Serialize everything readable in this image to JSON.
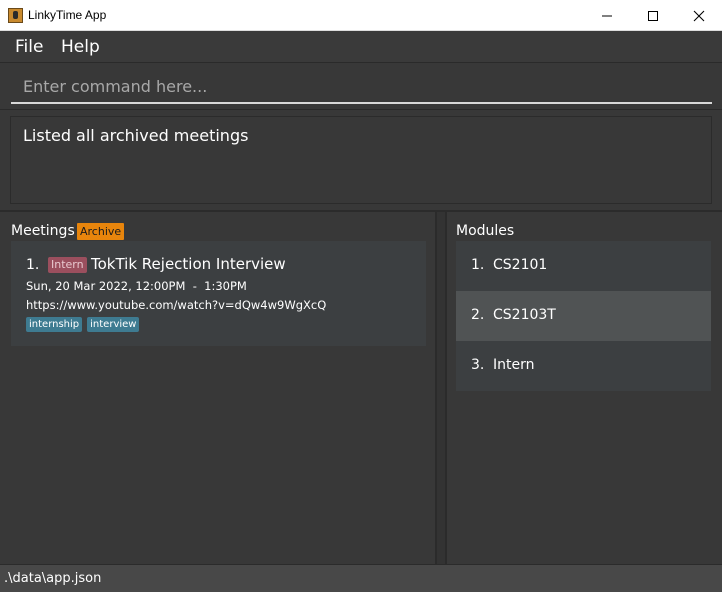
{
  "window": {
    "title": "LinkyTime App",
    "controls": {
      "minimize": "─",
      "maximize": "☐",
      "close": "✕"
    }
  },
  "menu": {
    "items": [
      {
        "label": "File"
      },
      {
        "label": "Help"
      }
    ]
  },
  "command": {
    "placeholder": "Enter command here...",
    "value": ""
  },
  "result": {
    "text": "Listed all archived meetings"
  },
  "meetings_panel": {
    "title": "Meetings",
    "badge": "Archive",
    "badge_color": "#e8850c",
    "meetings": [
      {
        "index": "1.",
        "module": "Intern",
        "title": "TokTik Rejection Interview",
        "time": "Sun, 20 Mar 2022, 12:00PM  -  1:30PM",
        "url": "https://www.youtube.com/watch?v=dQw4w9WgXcQ",
        "tags": [
          "internship",
          "interview"
        ]
      }
    ]
  },
  "modules_panel": {
    "title": "Modules",
    "modules": [
      {
        "index": "1.",
        "name": "CS2101",
        "selected": false
      },
      {
        "index": "2.",
        "name": "CS2103T",
        "selected": true
      },
      {
        "index": "3.",
        "name": "Intern",
        "selected": false
      }
    ]
  },
  "status": {
    "path": ".\\data\\app.json"
  },
  "colors": {
    "background": "#383838",
    "card": "#3c3f41",
    "selected": "#505354",
    "module_tag": "#9b4f5e",
    "tag": "#3e7b91"
  }
}
